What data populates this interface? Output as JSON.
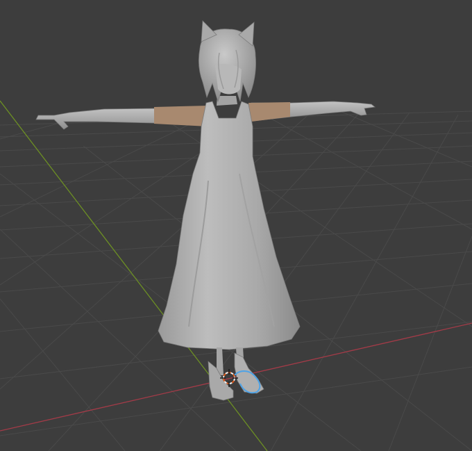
{
  "viewport": {
    "background": "#3d3d3d",
    "grid_color": "#4a4a4a",
    "x_axis_color": "#a43b48",
    "y_axis_color": "#6c8f24"
  },
  "model": {
    "skin_color": "#b3b3b3",
    "shade_color": "#8c8c8c",
    "arm_skin_color": "#a8896f",
    "selection_color": "#4fa3e6"
  },
  "cursor_3d": {
    "icon": "3d-cursor-icon",
    "color_a": "#e05a1a",
    "color_b": "#f2f2f2"
  }
}
